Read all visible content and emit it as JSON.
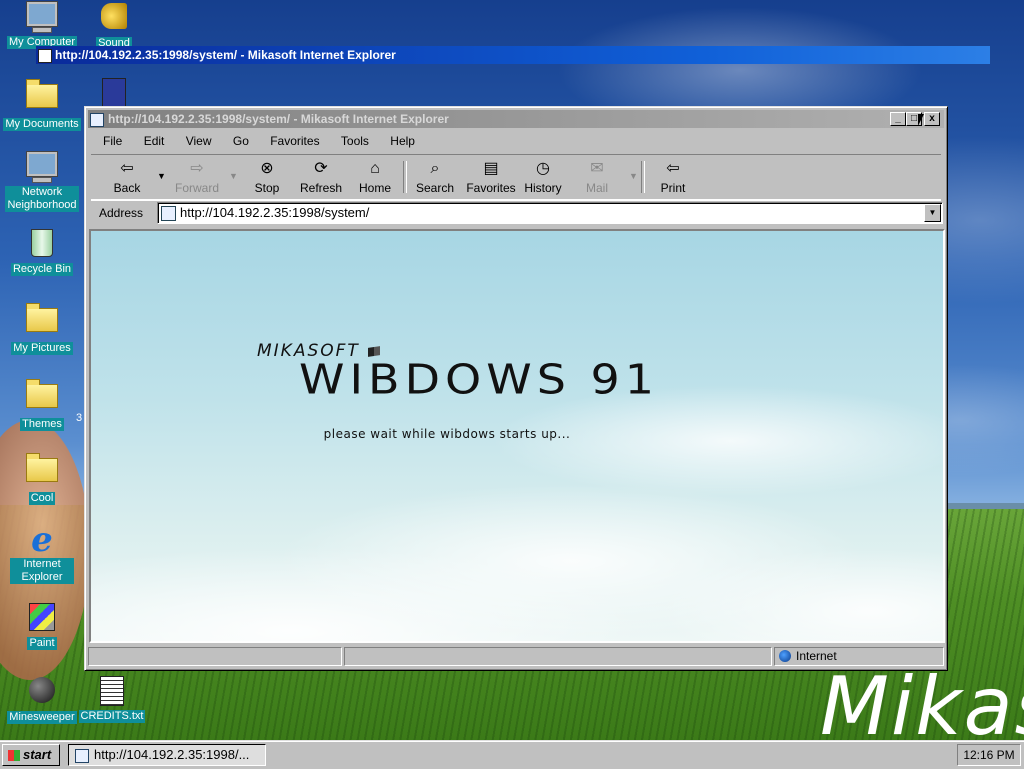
{
  "desktop": {
    "icons": [
      {
        "label": "My Computer"
      },
      {
        "label": "Sound"
      },
      {
        "label": "My Documents"
      },
      {
        "label": "Network Neighborhood"
      },
      {
        "label": "Recycle Bin"
      },
      {
        "label": "My Pictures"
      },
      {
        "label": "Themes"
      },
      {
        "label": "Cool"
      },
      {
        "label": "Internet Explorer"
      },
      {
        "label": "Paint"
      },
      {
        "label": "Minesweeper"
      },
      {
        "label": "CREDITS.txt"
      }
    ],
    "themes_badge": "3",
    "wallpaper_text": "Mikas"
  },
  "overlay_title": "http://104.192.2.35:1998/system/ - Mikasoft Internet Explorer",
  "window": {
    "title": "http://104.192.2.35:1998/system/ - Mikasoft Internet Explorer",
    "controls": {
      "minimize": "_",
      "maximize": "□",
      "close": "x"
    },
    "menu": [
      "File",
      "Edit",
      "View",
      "Go",
      "Favorites",
      "Tools",
      "Help"
    ],
    "toolbar": [
      {
        "label": "Back",
        "icon": "back-arrow-icon",
        "enabled": true
      },
      {
        "label": "Forward",
        "icon": "forward-arrow-icon",
        "enabled": false
      },
      {
        "label": "Stop",
        "icon": "stop-icon",
        "enabled": true
      },
      {
        "label": "Refresh",
        "icon": "refresh-icon",
        "enabled": true
      },
      {
        "label": "Home",
        "icon": "home-icon",
        "enabled": true
      },
      {
        "label": "Search",
        "icon": "search-icon",
        "enabled": true
      },
      {
        "label": "Favorites",
        "icon": "favorites-icon",
        "enabled": true
      },
      {
        "label": "History",
        "icon": "history-icon",
        "enabled": true
      },
      {
        "label": "Mail",
        "icon": "mail-icon",
        "enabled": false
      },
      {
        "label": "Print",
        "icon": "print-icon",
        "enabled": true
      }
    ],
    "address": {
      "label": "Address",
      "value": "http://104.192.2.35:1998/system/"
    },
    "page": {
      "brand": "MIKASOFT",
      "product": "WIBDOWS 91",
      "message": "please wait while wibdows starts up..."
    },
    "status": {
      "zone": "Internet"
    }
  },
  "taskbar": {
    "start": "start",
    "tasks": [
      {
        "label": "http://104.192.2.35:1998/..."
      }
    ],
    "clock": "12:16 PM"
  },
  "colors": {
    "accent": "#0a2a9a",
    "icon_label_bg": "#0f8f9a",
    "chrome": "#c0c0c0"
  }
}
